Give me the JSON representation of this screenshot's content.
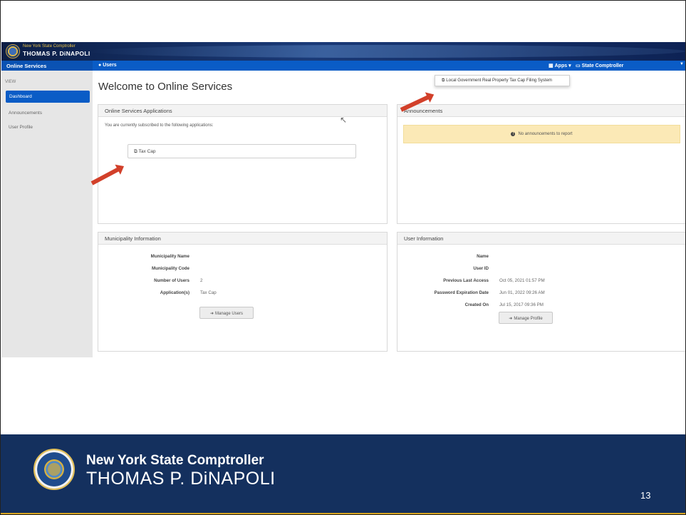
{
  "banner": {
    "line1": "New York State Comptroller",
    "line2": "THOMAS P. DiNAPOLI"
  },
  "navbar": {
    "brand": "Online Services",
    "users": "Users",
    "apps": "Apps ▾",
    "state_comptroller": "State Comptroller"
  },
  "dropdown": {
    "item": "Local Government Real Property Tax Cap Filing System"
  },
  "sidebar": {
    "section_label": "VIEW",
    "items": [
      "Dashboard",
      "Announcements",
      "User Profile"
    ],
    "active": "Dashboard"
  },
  "page_title": "Welcome to Online Services",
  "apps_panel": {
    "title": "Online Services Applications",
    "intro": "You are currently subscribed to the following applications:",
    "app": "Tax Cap"
  },
  "announcements_panel": {
    "title": "Announcements",
    "message": "No announcements to report"
  },
  "municipality_panel": {
    "title": "Municipality Information",
    "rows": [
      {
        "label": "Municipality Name",
        "value": ""
      },
      {
        "label": "Municipality Code",
        "value": ""
      },
      {
        "label": "Number of Users",
        "value": "2"
      },
      {
        "label": "Application(s)",
        "value": "Tax Cap"
      }
    ],
    "button": "Manage Users"
  },
  "user_panel": {
    "title": "User Information",
    "rows": [
      {
        "label": "Name",
        "value": ""
      },
      {
        "label": "User ID",
        "value": ""
      },
      {
        "label": "Previous Last Access",
        "value": "Oct 05, 2021 01:57 PM"
      },
      {
        "label": "Password Expiration Date",
        "value": "Jun 01, 2022 09:26 AM"
      },
      {
        "label": "Created On",
        "value": "Jul 15, 2017 09:36 PM"
      }
    ],
    "button": "Manage Profile"
  },
  "footer": {
    "line1": "New York State Comptroller",
    "line2": "THOMAS P. DiNAPOLI",
    "page_number": "13"
  },
  "colors": {
    "nav_blue": "#0a5cc6",
    "footer_navy": "#14305e",
    "footer_gold": "#d9a520",
    "arrow_red": "#d2402a",
    "alert_yellow": "#fbe9b6"
  }
}
